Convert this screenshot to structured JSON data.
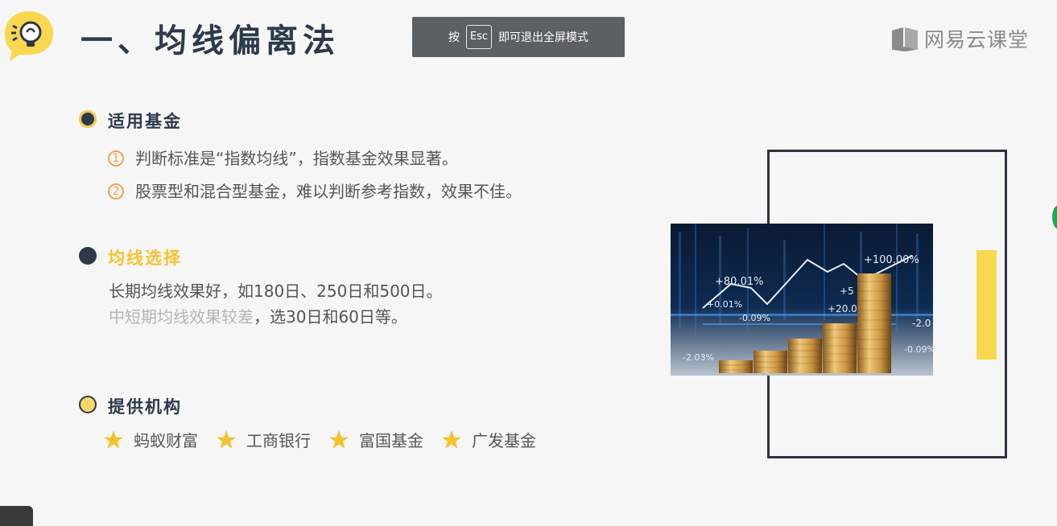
{
  "header": {
    "title": "一、均线偏离法",
    "icon": "lightbulb-icon"
  },
  "toast": {
    "prefix": "按",
    "key": "Esc",
    "suffix": "即可退出全屏模式"
  },
  "brand": {
    "name": "网易云课堂",
    "icon": "book-icon"
  },
  "sections": {
    "applicable": {
      "title": "适用基金",
      "items": [
        {
          "num": "1",
          "text": "判断标准是“指数均线”，指数基金效果显著。"
        },
        {
          "num": "2",
          "text": "股票型和混合型基金，难以判断参考指数，效果不佳。"
        }
      ]
    },
    "ma_choice": {
      "title": "均线选择",
      "line1": "长期均线效果好，如180日、250日和500日。",
      "line2_faded": "中短期均线效果较差",
      "line2_rest": "，选30日和60日等。"
    },
    "institutions": {
      "title": "提供机构",
      "items": [
        "蚂蚁财富",
        "工商银行",
        "富国基金",
        "广发基金"
      ],
      "star_color": "#f5c22e"
    }
  },
  "photo": {
    "labels": [
      "+100.00%",
      "+80.01%",
      "+0.01%",
      "-0.09%",
      "+20.0",
      "+5",
      "-2.0",
      "-2.03%",
      "-0.09%"
    ]
  },
  "colors": {
    "navy": "#2c3a4b",
    "accent_yellow": "#f9d850",
    "accent_orange": "#f0a254"
  }
}
